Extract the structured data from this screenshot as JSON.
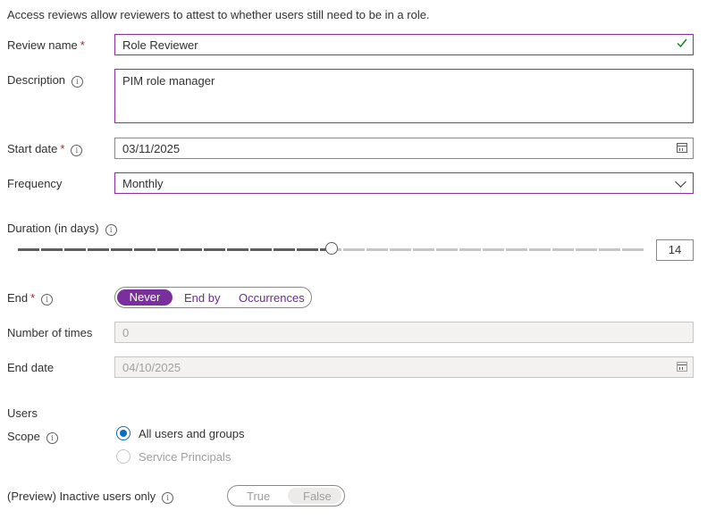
{
  "intro": "Access reviews allow reviewers to attest to whether users still need to be in a role.",
  "review_name": {
    "label": "Review name",
    "required": "*",
    "value": "Role Reviewer"
  },
  "description": {
    "label": "Description",
    "value": "PIM role manager"
  },
  "start_date": {
    "label": "Start date",
    "required": "*",
    "value": "03/11/2025"
  },
  "frequency": {
    "label": "Frequency",
    "value": "Monthly"
  },
  "duration": {
    "label": "Duration (in days)",
    "value": "14",
    "slider_fraction": 0.5
  },
  "end": {
    "label": "End",
    "required": "*",
    "options": [
      "Never",
      "End by",
      "Occurrences"
    ],
    "selected": "Never"
  },
  "number_of_times": {
    "label": "Number of times",
    "value": "0"
  },
  "end_date": {
    "label": "End date",
    "value": "04/10/2025"
  },
  "users": {
    "heading": "Users",
    "scope_label": "Scope",
    "options": [
      "All users and groups",
      "Service Principals"
    ],
    "selected": "All users and groups"
  },
  "inactive_users": {
    "label": "(Preview) Inactive users only",
    "options": [
      "True",
      "False"
    ],
    "selected": "False"
  },
  "colors": {
    "accent": "#7b2f9e",
    "radio": "#0f6cbd",
    "valid": "#107c10"
  }
}
